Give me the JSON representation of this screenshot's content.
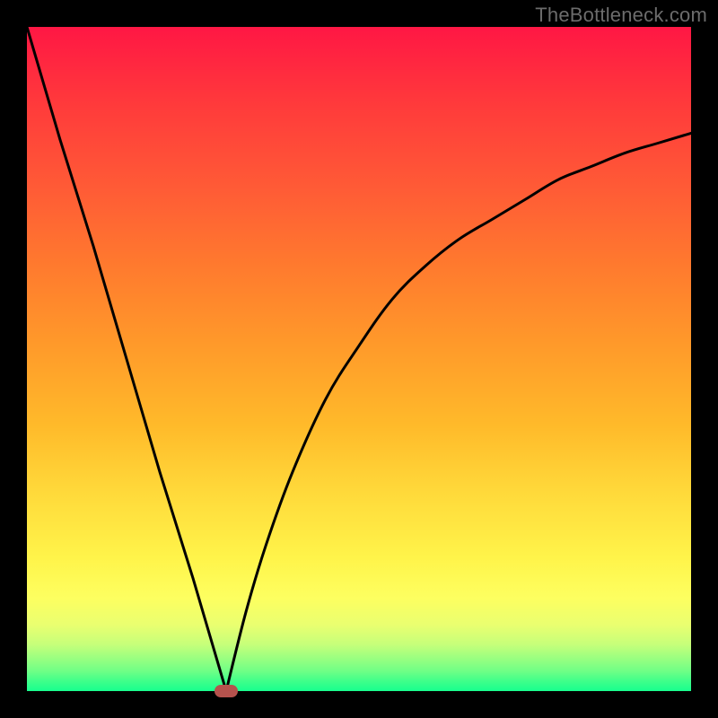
{
  "watermark": "TheBottleneck.com",
  "colors": {
    "frame": "#000000",
    "gradient_top": "#ff1744",
    "gradient_bottom": "#18ff8e",
    "curve": "#000000",
    "marker": "#b5524d"
  },
  "chart_data": {
    "type": "line",
    "title": "",
    "xlabel": "",
    "ylabel": "",
    "xlim": [
      0,
      100
    ],
    "ylim": [
      0,
      100
    ],
    "grid": false,
    "legend": false,
    "series": [
      {
        "name": "left-branch",
        "x": [
          0,
          5,
          10,
          15,
          20,
          25,
          30
        ],
        "y": [
          100,
          83,
          67,
          50,
          33,
          17,
          0
        ]
      },
      {
        "name": "right-branch",
        "x": [
          30,
          33,
          36,
          40,
          45,
          50,
          55,
          60,
          65,
          70,
          75,
          80,
          85,
          90,
          95,
          100
        ],
        "y": [
          0,
          12,
          22,
          33,
          44,
          52,
          59,
          64,
          68,
          71,
          74,
          77,
          79,
          81,
          82.5,
          84
        ]
      }
    ],
    "marker": {
      "x": 30,
      "y": 0
    },
    "notes": "Values are percentages of plot width/height estimated from the image; no numeric axes are shown."
  }
}
